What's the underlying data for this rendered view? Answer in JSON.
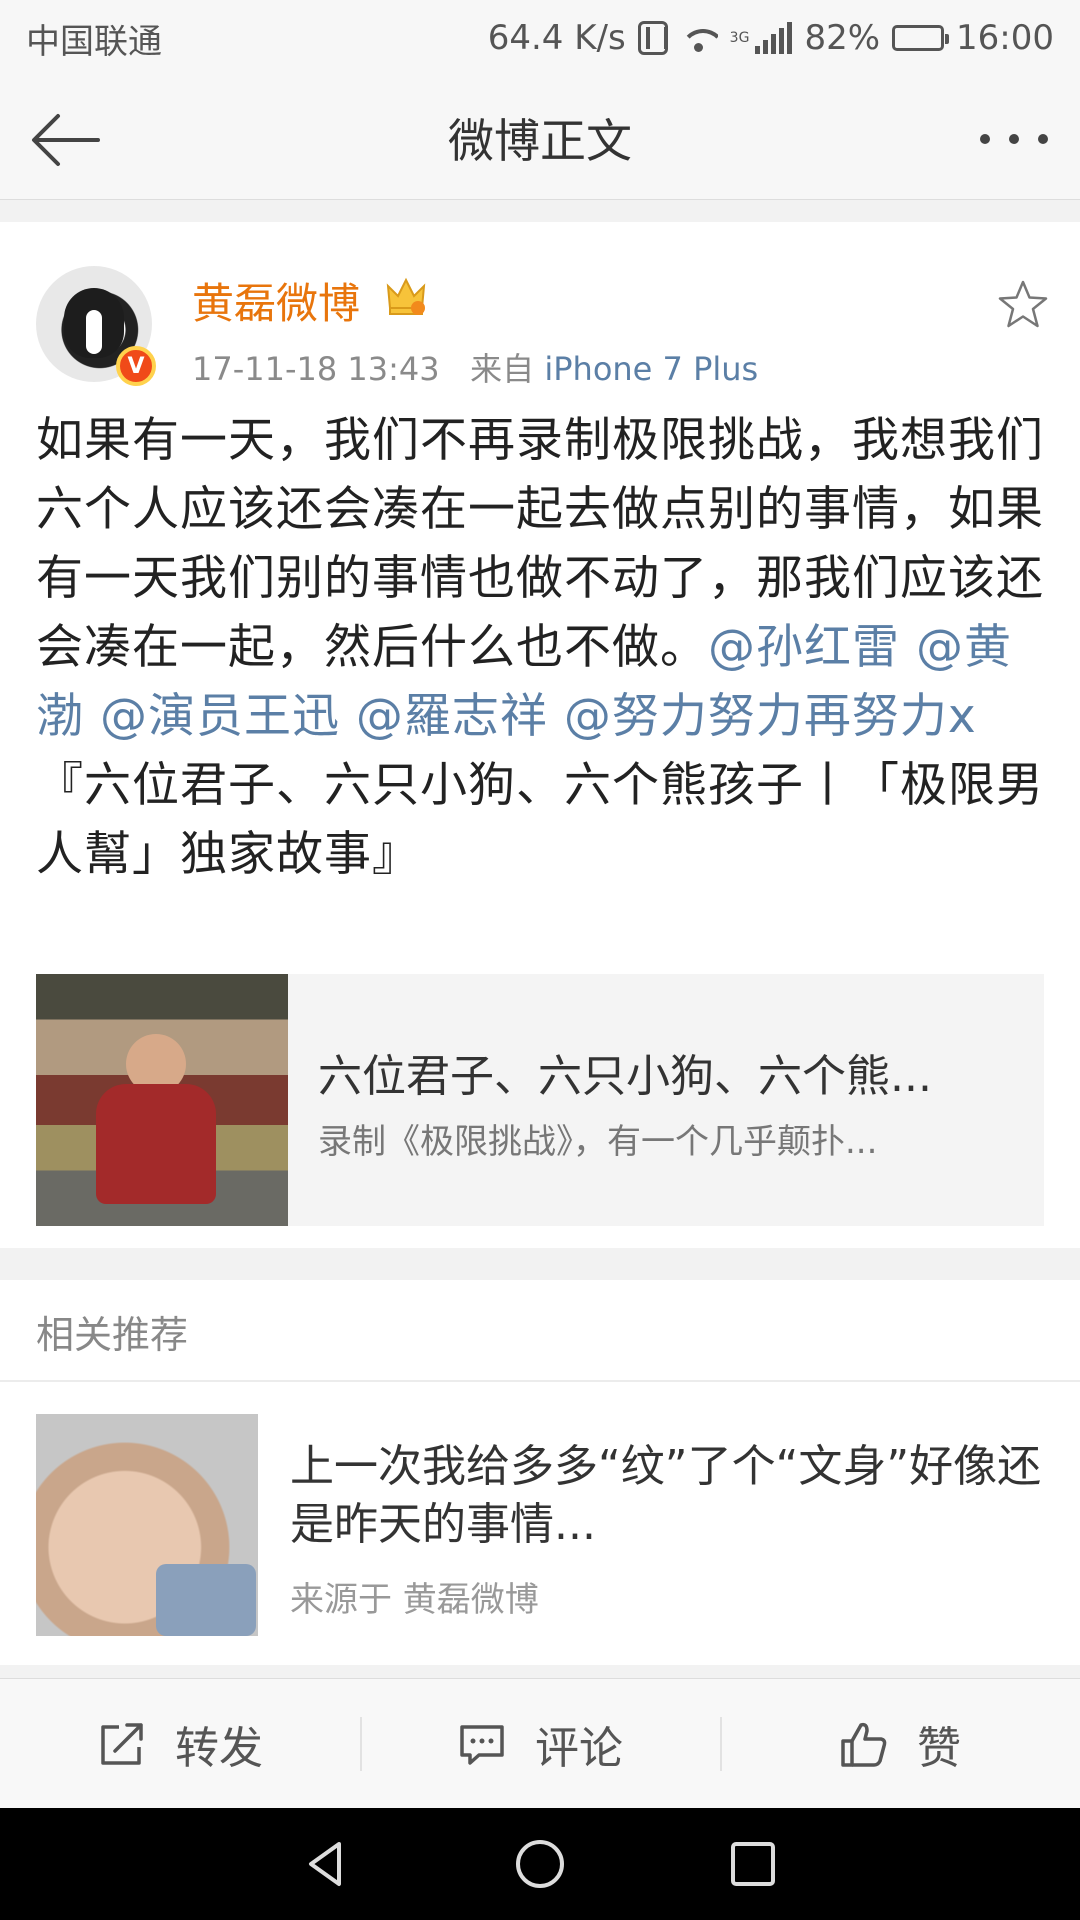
{
  "status_bar": {
    "carrier": "中国联通",
    "speed": "64.4 K/s",
    "network_type": "3G",
    "battery": "82%",
    "battery_level": 0.82,
    "time": "16:00"
  },
  "header": {
    "title": "微博正文"
  },
  "post": {
    "author": "黄磊微博",
    "timestamp": "17-11-18 13:43",
    "source_prefix": "来自",
    "source_device": "iPhone 7 Plus",
    "body_text": "如果有一天，我们不再录制极限挑战，我想我们六个人应该还会凑在一起去做点别的事情，如果有一天我们别的事情也做不动了，那我们应该还会凑在一起，然后什么也不做。",
    "mentions": [
      "@孙红雷",
      "@黄渤",
      "@演员王迅",
      "@羅志祥",
      "@努力努力再努力x"
    ],
    "body_tail": "『六位君子、六只小狗、六个熊孩子丨「极限男人幫」独家故事』",
    "link_card": {
      "title": "六位君子、六只小狗、六个熊...",
      "description": "录制《极限挑战》，有一个几乎颠扑..."
    }
  },
  "related": {
    "header": "相关推荐",
    "item": {
      "title": "上一次我给多多“纹”了个“文身”好像还是昨天的事情...",
      "source": "来源于 黄磊微博"
    }
  },
  "actions": {
    "repost": "转发",
    "comment": "评论",
    "like": "赞"
  },
  "colors": {
    "author_name": "#e8750c",
    "link_blue": "#5b7fa6",
    "verified_badge": "#f04a19"
  }
}
